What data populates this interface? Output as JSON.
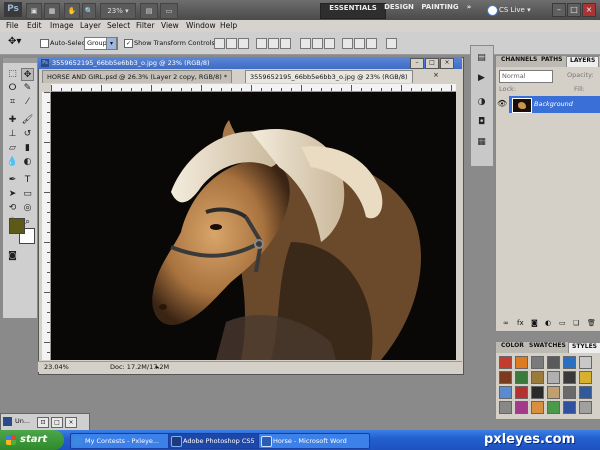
{
  "app": {
    "logo": "Ps",
    "zoom_select": "23%",
    "workspaces": [
      "ESSENTIALS",
      "DESIGN",
      "PAINTING"
    ],
    "more": "»",
    "cs_live": "CS Live",
    "window_controls": [
      "–",
      "□",
      "×"
    ]
  },
  "menu": [
    "File",
    "Edit",
    "Image",
    "Layer",
    "Select",
    "Filter",
    "View",
    "Window",
    "Help"
  ],
  "options": {
    "auto_select_label": "Auto-Select:",
    "auto_select_value": "Group",
    "show_transform_label": "Show Transform Controls"
  },
  "document": {
    "tabs": [
      "HORSE AND GIRL.psd @ 26.3% (Layer 2 copy, RGB/8) *",
      "3559652195_66bb5e6bb3_o.jpg @ 23% (RGB/8)"
    ],
    "window_title": "3559652195_66bb5e6bb3_o.jpg @ 23% (RGB/8)",
    "status_zoom": "23.04%",
    "status_doc": "Doc: 17.2M/17.2M"
  },
  "layers_panel": {
    "tabs": [
      "CHANNELS",
      "PATHS",
      "LAYERS"
    ],
    "blend_mode": "Normal",
    "opacity_label": "Opacity:",
    "lock_label": "Lock:",
    "fill_label": "Fill:",
    "layer_name": "Background"
  },
  "styles_panel": {
    "tabs": [
      "COLOR",
      "SWATCHES",
      "STYLES"
    ],
    "swatch_colors": [
      "#c33b2c",
      "#e07a20",
      "#7a7a7a",
      "#5a5a5a",
      "#2b6fc2",
      "#c8c8c8",
      "#7a3b1e",
      "#3a7a3a",
      "#9b7b3a",
      "#b0b0b0",
      "#3a3a3a",
      "#d8b030",
      "#5a8ad0",
      "#b53030",
      "#2a2a2a",
      "#c0a070",
      "#6a6a6a",
      "#305a9a",
      "#888888",
      "#a33a8a",
      "#d89040",
      "#4a9a4a",
      "#3050a0",
      "#a0a0a0"
    ]
  },
  "minimized_panel": {
    "label": "Un..."
  },
  "taskbar": {
    "start": "start",
    "tasks": [
      "My Contests - Pxleye...",
      "Adobe Photoshop CS5",
      "Horse - Microsoft Word"
    ],
    "brand": "pxleyes.com"
  },
  "colors": {
    "foreground": "#5c5a16",
    "background": "#ffffff",
    "accent": "#3a6fd8"
  }
}
